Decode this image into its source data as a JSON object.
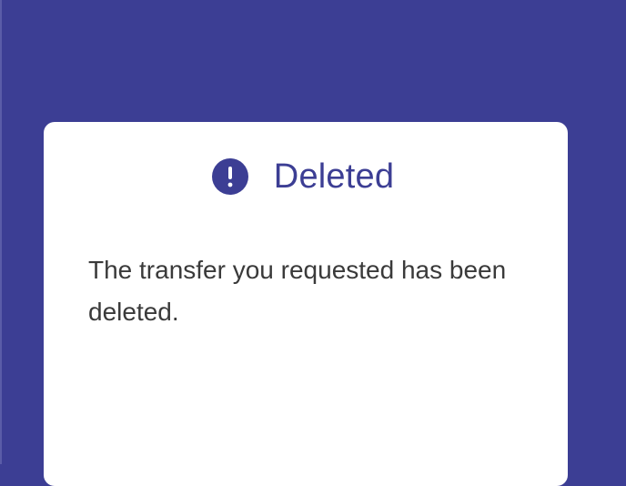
{
  "notice": {
    "icon": "exclamation-circle-icon",
    "title": "Deleted",
    "message": "The transfer you requested has been deleted."
  },
  "colors": {
    "background": "#3c3e94",
    "card": "#ffffff",
    "title": "#3c3e94",
    "text": "#3a3a3a"
  }
}
